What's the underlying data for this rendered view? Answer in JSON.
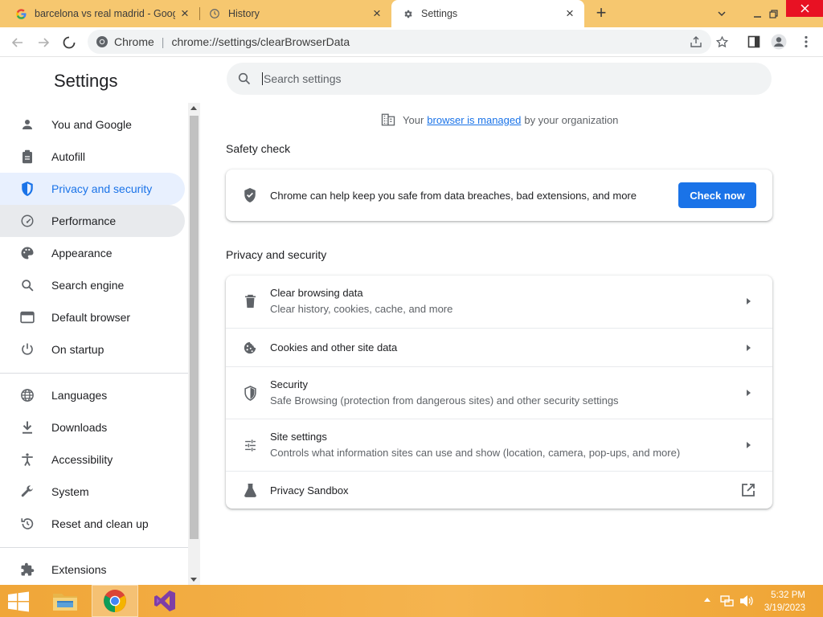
{
  "tabs": [
    {
      "title": "barcelona vs real madrid - Google Search",
      "icon": "google-icon"
    },
    {
      "title": "History",
      "icon": "history-icon"
    },
    {
      "title": "Settings",
      "icon": "gear-icon"
    }
  ],
  "omnibox": {
    "chip": "Chrome",
    "url": "chrome://settings/clearBrowserData"
  },
  "settings_title": "Settings",
  "search": {
    "placeholder": "Search settings"
  },
  "sidebar": {
    "items": [
      {
        "label": "You and Google",
        "icon": "person-icon"
      },
      {
        "label": "Autofill",
        "icon": "clipboard-icon"
      },
      {
        "label": "Privacy and security",
        "icon": "shield-icon"
      },
      {
        "label": "Performance",
        "icon": "speedometer-icon"
      },
      {
        "label": "Appearance",
        "icon": "palette-icon"
      },
      {
        "label": "Search engine",
        "icon": "search-icon"
      },
      {
        "label": "Default browser",
        "icon": "browser-icon"
      },
      {
        "label": "On startup",
        "icon": "power-icon"
      },
      {
        "label": "Languages",
        "icon": "globe-icon"
      },
      {
        "label": "Downloads",
        "icon": "download-icon"
      },
      {
        "label": "Accessibility",
        "icon": "accessibility-icon"
      },
      {
        "label": "System",
        "icon": "wrench-icon"
      },
      {
        "label": "Reset and clean up",
        "icon": "restore-icon"
      },
      {
        "label": "Extensions",
        "icon": "puzzle-icon"
      }
    ]
  },
  "managed": {
    "prefix": "Your",
    "link": "browser is managed",
    "suffix": "by your organization"
  },
  "safety_check": {
    "title": "Safety check",
    "text": "Chrome can help keep you safe from data breaches, bad extensions, and more",
    "button": "Check now"
  },
  "privacy": {
    "title": "Privacy and security",
    "rows": [
      {
        "primary": "Clear browsing data",
        "secondary": "Clear history, cookies, cache, and more",
        "icon": "trash-icon"
      },
      {
        "primary": "Cookies and other site data",
        "secondary": "",
        "icon": "cookie-icon"
      },
      {
        "primary": "Security",
        "secondary": "Safe Browsing (protection from dangerous sites) and other security settings",
        "icon": "shield-icon"
      },
      {
        "primary": "Site settings",
        "secondary": "Controls what information sites can use and show (location, camera, pop-ups, and more)",
        "icon": "tune-icon"
      },
      {
        "primary": "Privacy Sandbox",
        "secondary": "",
        "icon": "flask-icon"
      }
    ]
  },
  "clock": {
    "time": "5:32 PM",
    "date": "3/19/2023"
  },
  "colors": {
    "accent": "#1a73e8",
    "tabstrip": "#f6c76f",
    "taskbar": "#f2ae42",
    "close": "#e81123"
  }
}
